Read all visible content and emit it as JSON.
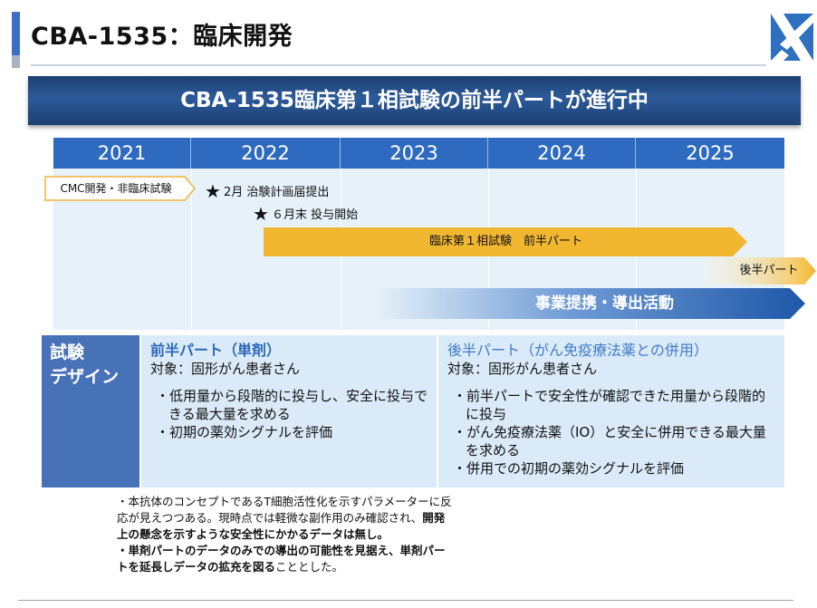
{
  "header": {
    "title": "CBA-1535：臨床開発"
  },
  "banner": {
    "text": "CBA-1535臨床第１相試験の前半パートが進行中"
  },
  "timeline": {
    "years": [
      "2021",
      "2022",
      "2023",
      "2024",
      "2025"
    ],
    "cmc_label": "CMC開発・非臨床試験",
    "milestones": [
      {
        "star": "★",
        "label": "2月 治験計画届提出"
      },
      {
        "star": "★",
        "label": "６月末 投与開始"
      }
    ],
    "phase1_first_half": "臨床第１相試験　前半パート",
    "second_half": "後半パート",
    "business": "事業提携・導出活動",
    "colors": {
      "year_header": "#2d6ac0",
      "background": "#e6f1fa",
      "first_half_arrow": "#f2b731",
      "business_arrow": "#2f63b1"
    }
  },
  "design": {
    "heading_line1": "試験",
    "heading_line2": "デザイン",
    "first_half": {
      "title": "前半パート（単剤）",
      "target": "対象：固形がん患者さん",
      "bullets": [
        "・低用量から段階的に投与し、安全に投与できる最大量を求める",
        "・初期の薬効シグナルを評価"
      ]
    },
    "second_half": {
      "title": "後半パート（がん免疫療法薬との併用）",
      "target": "対象：固形がん患者さん",
      "bullets": [
        "・前半パートで安全性が確認できた用量から段階的に投与",
        "・がん免疫療法薬（IO）と安全に併用できる最大量を求める",
        "・併用での初期の薬効シグナルを評価"
      ]
    }
  },
  "notes": {
    "line1_plain": "・本抗体のコンセプトであるT細胞活性化を示すパラメーターに反応が見えつつある。現時点では軽微な副作用のみ確認され、",
    "line1_bold": "開発上の懸念を示すような安全性にかかるデータは無し。",
    "line2_bold": "・単剤パートのデータのみでの導出の可能性を見据え、単剤パートを延長しデータの拡充を図る",
    "line2_plain": "こととした。"
  },
  "logo": {
    "icon": "company-logo-icon"
  }
}
